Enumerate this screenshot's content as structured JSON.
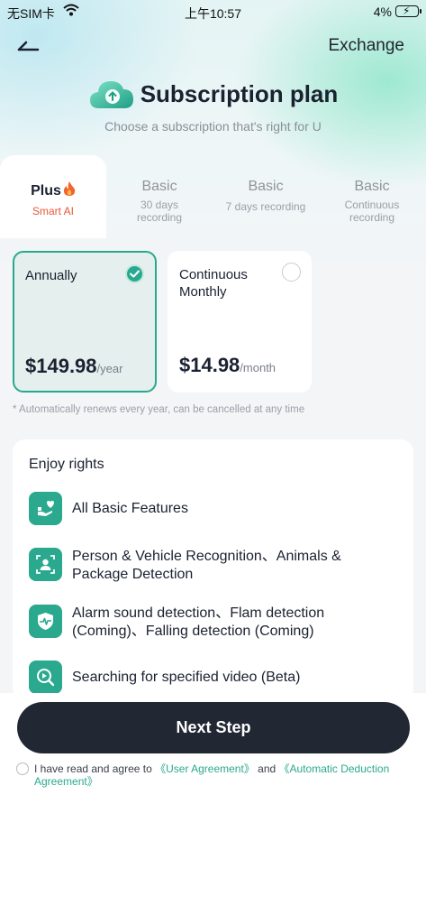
{
  "status_bar": {
    "carrier": "无SIM卡",
    "time": "上午10:57",
    "battery_pct": "4%"
  },
  "header": {
    "exchange_label": "Exchange",
    "title": "Subscription plan",
    "subtitle": "Choose a subscription that's right for U"
  },
  "tabs": [
    {
      "name": "Plus",
      "desc": "Smart AI",
      "active": true
    },
    {
      "name": "Basic",
      "desc": "30 days recording"
    },
    {
      "name": "Basic",
      "desc": "7 days recording"
    },
    {
      "name": "Basic",
      "desc": "Continuous recording"
    }
  ],
  "plans": [
    {
      "name": "Annually",
      "price": "$149.98",
      "unit": "/year",
      "selected": true
    },
    {
      "name": "Continuous Monthly",
      "price": "$14.98",
      "unit": "/month",
      "selected": false
    }
  ],
  "renew_note": "* Automatically renews every year, can be cancelled at any time",
  "rights": {
    "title": "Enjoy rights",
    "items": [
      {
        "text": "All Basic Features",
        "icon": "hand-heart-icon"
      },
      {
        "text": "Person & Vehicle Recognition、Animals & Package Detection",
        "icon": "face-scan-icon"
      },
      {
        "text": "Alarm sound detection、Flam detection (Coming)、Falling detection (Coming)",
        "icon": "shield-pulse-icon"
      },
      {
        "text": "Searching for specified video (Beta)",
        "icon": "search-video-icon"
      }
    ]
  },
  "next_button": "Next Step",
  "agreement": {
    "prefix": "I have read and agree to ",
    "user_agreement": "《User Agreement》",
    "and": " and ",
    "deduction_agreement": "《Automatic Deduction Agreement》"
  },
  "colors": {
    "accent": "#2aa98e",
    "button_dark": "#222734",
    "hot": "#e8563a"
  }
}
